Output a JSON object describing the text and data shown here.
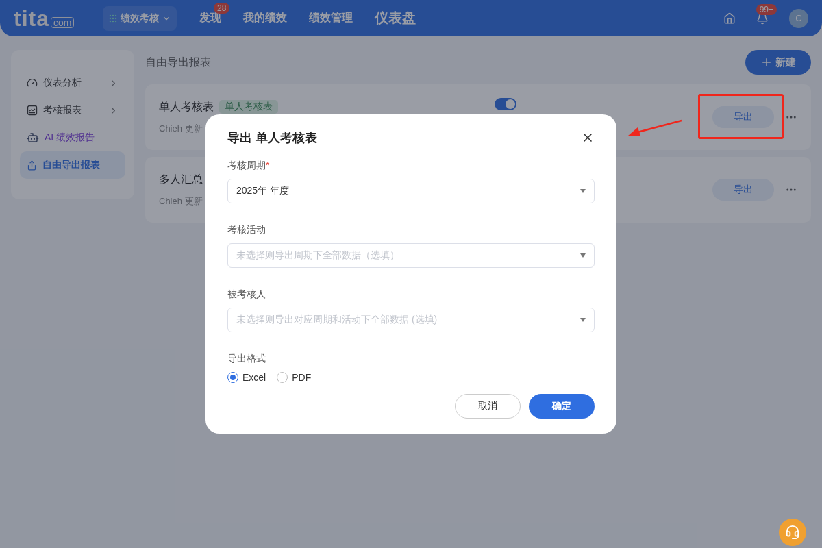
{
  "header": {
    "logo": "tita",
    "logo_suffix": "com",
    "app_switcher": "绩效考核",
    "nav": [
      {
        "label": "发现",
        "badge": "28",
        "selected": false
      },
      {
        "label": "我的绩效",
        "selected": false
      },
      {
        "label": "绩效管理",
        "selected": false
      },
      {
        "label": "仪表盘",
        "selected": true
      }
    ],
    "notification_badge": "99+",
    "avatar": "C"
  },
  "sidebar": {
    "items": [
      {
        "kind": "gauge",
        "label": "仪表分析",
        "expandable": true,
        "selected": false
      },
      {
        "kind": "chart",
        "label": "考核报表",
        "expandable": true,
        "selected": false
      },
      {
        "kind": "ai",
        "label_prefix": "AI",
        "label": "绩效报告",
        "expandable": false,
        "selected": false
      },
      {
        "kind": "export",
        "label": "自由导出报表",
        "expandable": false,
        "selected": true
      }
    ]
  },
  "main": {
    "title": "自由导出报表",
    "new_button": "新建",
    "reports": [
      {
        "name": "单人考核表",
        "tag": "单人考核表",
        "author": "Chieh",
        "meta": "更新",
        "enabled": true,
        "export_button": "导出"
      },
      {
        "name": "多人汇总",
        "author": "Chieh",
        "meta": "更新",
        "export_button": "导出"
      }
    ]
  },
  "dialog": {
    "title": "导出 单人考核表",
    "fields": [
      {
        "label": "考核周期",
        "required_mark": "*",
        "value": "2025年 年度"
      },
      {
        "label": "考核活动",
        "placeholder": "未选择则导出周期下全部数据（选填）"
      },
      {
        "label": "被考核人",
        "placeholder": "未选择则导出对应周期和活动下全部数据 (选填)"
      }
    ],
    "format": {
      "label": "导出格式",
      "options": [
        {
          "label": "Excel",
          "selected": true
        },
        {
          "label": "PDF",
          "selected": false
        }
      ]
    },
    "cancel_button": "取消",
    "confirm_button": "确定"
  }
}
